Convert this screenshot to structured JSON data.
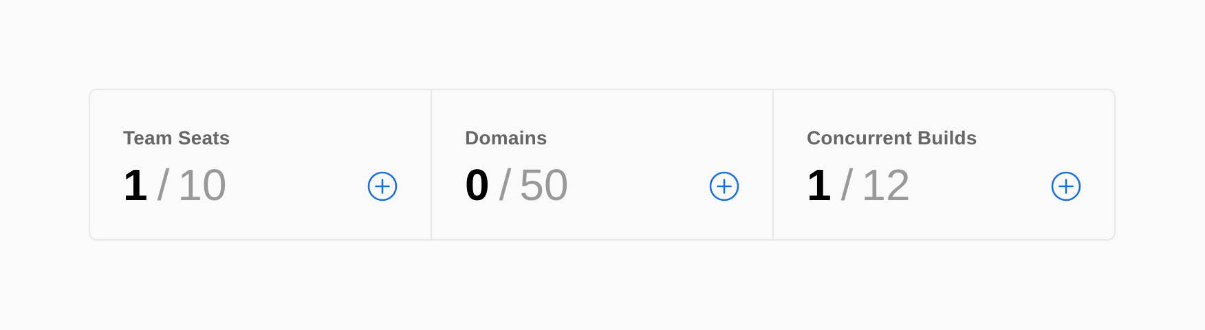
{
  "accent_color": "#1a6fe0",
  "usage": {
    "items": [
      {
        "label": "Team Seats",
        "used": "1",
        "separator": "/",
        "limit": "10",
        "action_icon": "plus-circle-icon"
      },
      {
        "label": "Domains",
        "used": "0",
        "separator": "/",
        "limit": "50",
        "action_icon": "plus-circle-icon"
      },
      {
        "label": "Concurrent Builds",
        "used": "1",
        "separator": "/",
        "limit": "12",
        "action_icon": "plus-circle-icon"
      }
    ]
  }
}
